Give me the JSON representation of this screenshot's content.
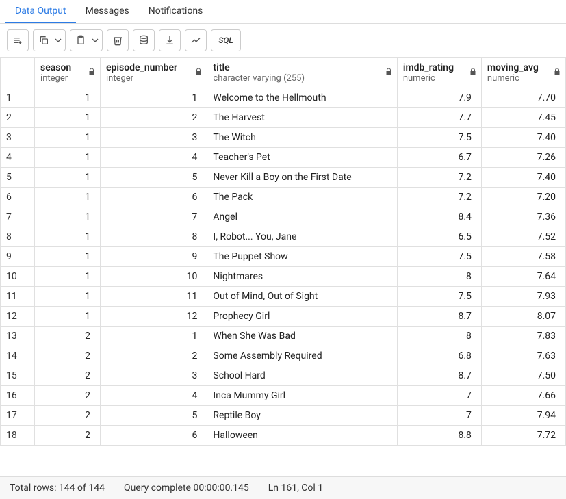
{
  "tabs": [
    {
      "label": "Data Output",
      "active": true
    },
    {
      "label": "Messages",
      "active": false
    },
    {
      "label": "Notifications",
      "active": false
    }
  ],
  "toolbar": {
    "add_row": "Add row",
    "copy": "Copy",
    "copy_menu": "Copy options",
    "paste": "Paste",
    "paste_menu": "Paste options",
    "delete": "Delete",
    "save": "Save data changes",
    "download": "Download",
    "chart": "Graph Visualiser",
    "sql": "SQL"
  },
  "columns": [
    {
      "name": "season",
      "type": "integer"
    },
    {
      "name": "episode_number",
      "type": "integer"
    },
    {
      "name": "title",
      "type": "character varying (255)"
    },
    {
      "name": "imdb_rating",
      "type": "numeric"
    },
    {
      "name": "moving_avg",
      "type": "numeric"
    }
  ],
  "rows": [
    {
      "n": "1",
      "season": "1",
      "episode_number": "1",
      "title": "Welcome to the Hellmouth",
      "imdb_rating": "7.9",
      "moving_avg": "7.70"
    },
    {
      "n": "2",
      "season": "1",
      "episode_number": "2",
      "title": "The Harvest",
      "imdb_rating": "7.7",
      "moving_avg": "7.45"
    },
    {
      "n": "3",
      "season": "1",
      "episode_number": "3",
      "title": "The Witch",
      "imdb_rating": "7.5",
      "moving_avg": "7.40"
    },
    {
      "n": "4",
      "season": "1",
      "episode_number": "4",
      "title": "Teacher's Pet",
      "imdb_rating": "6.7",
      "moving_avg": "7.26"
    },
    {
      "n": "5",
      "season": "1",
      "episode_number": "5",
      "title": "Never Kill a Boy on the First Date",
      "imdb_rating": "7.2",
      "moving_avg": "7.40"
    },
    {
      "n": "6",
      "season": "1",
      "episode_number": "6",
      "title": "The Pack",
      "imdb_rating": "7.2",
      "moving_avg": "7.20"
    },
    {
      "n": "7",
      "season": "1",
      "episode_number": "7",
      "title": "Angel",
      "imdb_rating": "8.4",
      "moving_avg": "7.36"
    },
    {
      "n": "8",
      "season": "1",
      "episode_number": "8",
      "title": "I, Robot... You, Jane",
      "imdb_rating": "6.5",
      "moving_avg": "7.52"
    },
    {
      "n": "9",
      "season": "1",
      "episode_number": "9",
      "title": "The Puppet Show",
      "imdb_rating": "7.5",
      "moving_avg": "7.58"
    },
    {
      "n": "10",
      "season": "1",
      "episode_number": "10",
      "title": "Nightmares",
      "imdb_rating": "8",
      "moving_avg": "7.64"
    },
    {
      "n": "11",
      "season": "1",
      "episode_number": "11",
      "title": "Out of Mind, Out of Sight",
      "imdb_rating": "7.5",
      "moving_avg": "7.93"
    },
    {
      "n": "12",
      "season": "1",
      "episode_number": "12",
      "title": "Prophecy Girl",
      "imdb_rating": "8.7",
      "moving_avg": "8.07"
    },
    {
      "n": "13",
      "season": "2",
      "episode_number": "1",
      "title": "When She Was Bad",
      "imdb_rating": "8",
      "moving_avg": "7.83"
    },
    {
      "n": "14",
      "season": "2",
      "episode_number": "2",
      "title": "Some Assembly Required",
      "imdb_rating": "6.8",
      "moving_avg": "7.63"
    },
    {
      "n": "15",
      "season": "2",
      "episode_number": "3",
      "title": "School Hard",
      "imdb_rating": "8.7",
      "moving_avg": "7.50"
    },
    {
      "n": "16",
      "season": "2",
      "episode_number": "4",
      "title": "Inca Mummy Girl",
      "imdb_rating": "7",
      "moving_avg": "7.66"
    },
    {
      "n": "17",
      "season": "2",
      "episode_number": "5",
      "title": "Reptile Boy",
      "imdb_rating": "7",
      "moving_avg": "7.94"
    },
    {
      "n": "18",
      "season": "2",
      "episode_number": "6",
      "title": "Halloween",
      "imdb_rating": "8.8",
      "moving_avg": "7.72"
    }
  ],
  "status": {
    "total_rows": "Total rows: 144 of 144",
    "query_complete": "Query complete 00:00:00.145",
    "cursor": "Ln 161, Col 1"
  }
}
